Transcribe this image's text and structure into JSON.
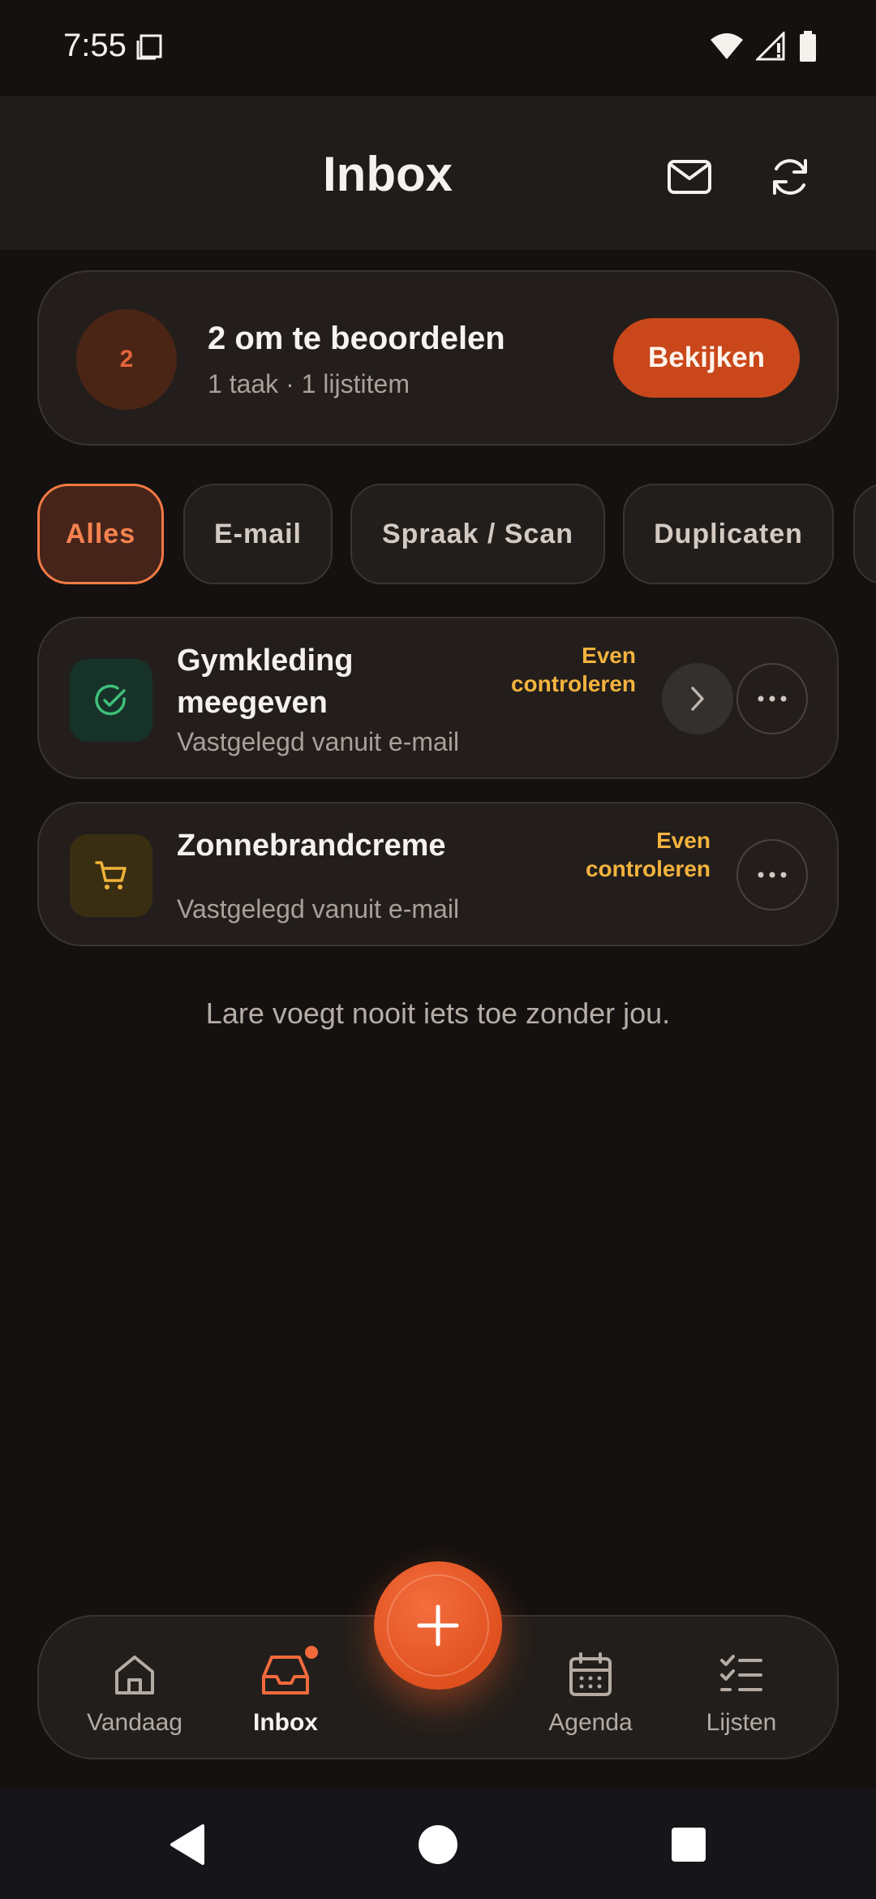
{
  "status_bar": {
    "time": "7:55"
  },
  "header": {
    "title": "Inbox"
  },
  "review_banner": {
    "count": "2",
    "title": "2 om te beoordelen",
    "subtitle": "1 taak · 1 lijstitem",
    "action_label": "Bekijken"
  },
  "filters": [
    {
      "label": "Alles",
      "active": true
    },
    {
      "label": "E-mail",
      "active": false
    },
    {
      "label": "Spraak / Scan",
      "active": false
    },
    {
      "label": "Duplicaten",
      "active": false
    }
  ],
  "items": [
    {
      "title_line1": "Gymkleding",
      "title_line2": "meegeven",
      "subtitle": "Vastgelegd vanuit e-mail",
      "status_line1": "Even",
      "status_line2": "controleren",
      "icon": "check-circle-icon",
      "icon_bg": "#173228",
      "icon_color": "#3fc07a"
    },
    {
      "title_line1": "Zonnebrandcreme",
      "subtitle": "Vastgelegd vanuit e-mail",
      "status_line1": "Even",
      "status_line2": "controleren",
      "icon": "shopping-cart-icon",
      "icon_bg": "#3a2e12",
      "icon_color": "#f0b43a"
    }
  ],
  "footer_note": "Lare voegt nooit iets toe zonder jou.",
  "nav": {
    "items": [
      {
        "label": "Vandaag",
        "icon": "home-icon"
      },
      {
        "label": "Inbox",
        "icon": "inbox-icon",
        "active": true
      },
      {
        "label": "Agenda",
        "icon": "calendar-icon"
      },
      {
        "label": "Lijsten",
        "icon": "checklist-icon"
      }
    ]
  },
  "colors": {
    "accent": "#e0501f",
    "background": "#141110",
    "card": "#231e1b",
    "warning": "#f3b33e"
  }
}
